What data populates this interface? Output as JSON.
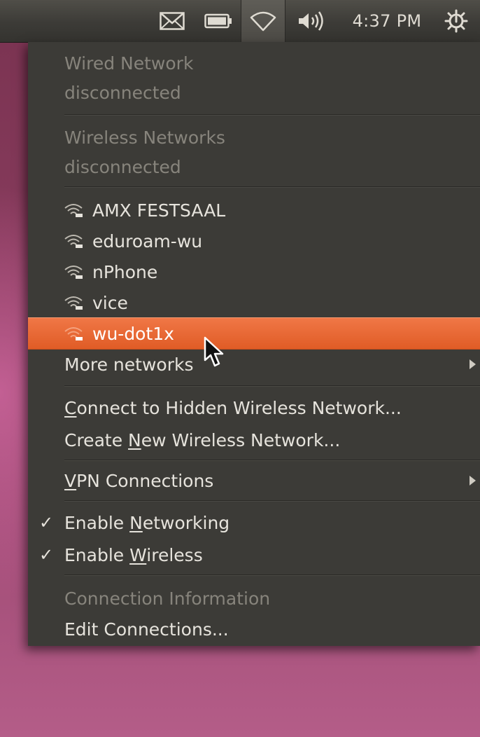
{
  "panel": {
    "icons": {
      "mail": "envelope-icon",
      "battery": "battery-icon",
      "network": "wifi-icon",
      "sound": "speaker-volume-icon",
      "session": "gear-power-icon"
    },
    "clock": "4:37 PM"
  },
  "menu": {
    "wired": {
      "title": "Wired Network",
      "status": "disconnected"
    },
    "wireless": {
      "title": "Wireless Networks",
      "status": "disconnected"
    },
    "networks": [
      {
        "name": "AMX FESTSAAL"
      },
      {
        "name": "eduroam-wu"
      },
      {
        "name": "nPhone"
      },
      {
        "name": "vice"
      },
      {
        "name": "wu-dot1x"
      }
    ],
    "more_networks": "More networks",
    "hidden": {
      "mnemonic": "C",
      "rest": "onnect to Hidden Wireless Network..."
    },
    "create": {
      "before": "Create ",
      "mnemonic": "N",
      "rest": "ew Wireless Network..."
    },
    "vpn": {
      "mnemonic": "V",
      "rest": "PN Connections"
    },
    "enable_networking": {
      "before": "Enable ",
      "mnemonic": "N",
      "rest": "etworking",
      "checked": "✓"
    },
    "enable_wireless": {
      "before": "Enable ",
      "mnemonic": "W",
      "rest": "ireless",
      "checked": "✓"
    },
    "connection_info": "Connection Information",
    "edit_connections": "Edit Connections...",
    "highlight_color": "#e8632d"
  }
}
